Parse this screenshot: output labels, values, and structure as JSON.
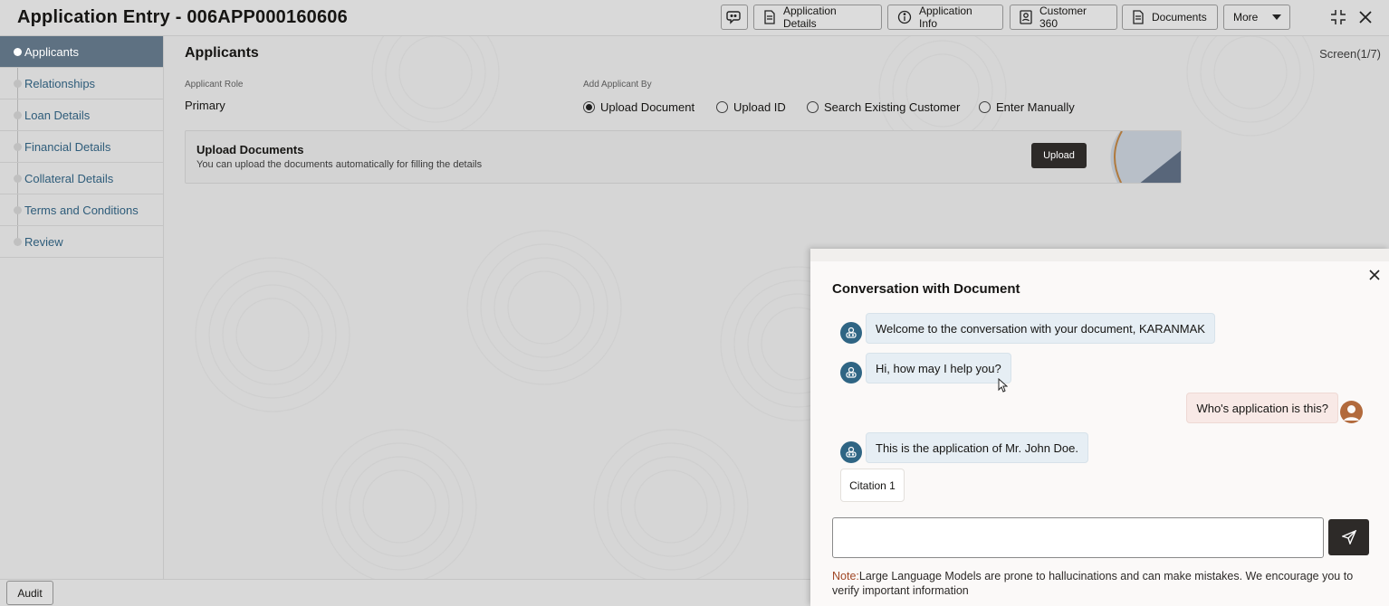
{
  "header": {
    "title": "Application Entry - 006APP000160606",
    "buttons": [
      {
        "label": "Application Details",
        "icon": "document-icon"
      },
      {
        "label": "Application Info",
        "icon": "info-icon"
      },
      {
        "label": "Customer 360",
        "icon": "customer-card-icon"
      },
      {
        "label": "Documents",
        "icon": "documents-icon"
      },
      {
        "label": "More",
        "icon": "caret-down-icon"
      }
    ]
  },
  "sidebar": {
    "items": [
      {
        "label": "Applicants",
        "active": true
      },
      {
        "label": "Relationships",
        "active": false
      },
      {
        "label": "Loan Details",
        "active": false
      },
      {
        "label": "Financial Details",
        "active": false
      },
      {
        "label": "Collateral Details",
        "active": false
      },
      {
        "label": "Terms and Conditions",
        "active": false
      },
      {
        "label": "Review",
        "active": false
      }
    ]
  },
  "main": {
    "title": "Applicants",
    "screen_count": "Screen(1/7)",
    "applicant_role_label": "Applicant Role",
    "applicant_role_value": "Primary",
    "add_by_label": "Add Applicant By",
    "add_by_options": [
      {
        "label": "Upload Document",
        "selected": true
      },
      {
        "label": "Upload ID",
        "selected": false
      },
      {
        "label": "Search Existing Customer",
        "selected": false
      },
      {
        "label": "Enter Manually",
        "selected": false
      }
    ],
    "upload_card": {
      "title": "Upload Documents",
      "description": "You can upload the documents automatically for filling the details",
      "button_label": "Upload"
    }
  },
  "footer": {
    "audit_label": "Audit"
  },
  "chat": {
    "title": "Conversation with Document",
    "messages": [
      {
        "role": "bot",
        "text": "Welcome to the conversation with your document, KARANMAK"
      },
      {
        "role": "bot",
        "text": "Hi, how may I help you?"
      },
      {
        "role": "user",
        "text": "Who's application is this?"
      },
      {
        "role": "bot",
        "text": "This is the application of Mr. John Doe."
      }
    ],
    "citation_label": "Citation 1",
    "input_value": "",
    "note_label": "Note:",
    "note_text": "Large Language Models are prone to hallucinations and can make mistakes. We encourage you to verify important information"
  },
  "colors": {
    "sidebar_active": "#5e7182",
    "link_text": "#2e5c7a",
    "bot_avatar": "#2f6584",
    "user_avatar": "#b26a3c",
    "dark_button": "#2d2a28",
    "note_label": "#a04725"
  }
}
